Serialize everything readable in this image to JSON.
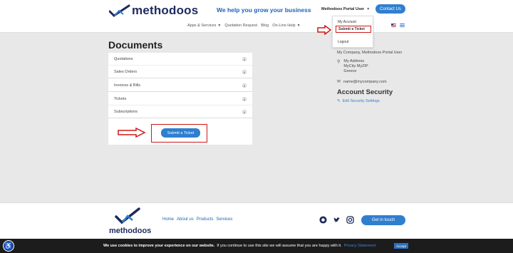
{
  "header": {
    "logo_text": "methodoos",
    "tagline": "We help you grow your business",
    "user_label": "Methodoos Portal User",
    "contact_label": "Contact Us"
  },
  "nav": {
    "items": [
      "Apps & Services",
      "Quotation Request",
      "Blog",
      "On-Line Help"
    ]
  },
  "dropdown": {
    "my_account": "My Account",
    "submit_ticket": "Submit a Ticket",
    "logout": "Logout"
  },
  "main": {
    "title": "Documents",
    "rows": [
      {
        "label": "Quotations",
        "count": "0"
      },
      {
        "label": "Sales Orders",
        "count": "0"
      },
      {
        "label": "Invoices & Bills",
        "count": "0"
      },
      {
        "label": "Tickets",
        "count": "0"
      },
      {
        "label": "Subscriptions",
        "count": "0"
      }
    ],
    "submit_button": "Submit a Ticket"
  },
  "profile": {
    "company": "My Company, Methodoos Portal User",
    "address": [
      "My Address",
      "MyCity MyZIP",
      "Greece"
    ],
    "email": "name@mycompany.com",
    "security_title": "Account Security",
    "security_link": "Edit Security Settings"
  },
  "footer": {
    "logo_text": "methodoos",
    "links": [
      "Home",
      "About us",
      "Products",
      "Services"
    ],
    "cta": "Get in touch"
  },
  "cookie": {
    "bold_text": "We use cookies to improve your experience on our website.",
    "text": "If you continue to use this site we will assume that you are happy with it.",
    "link": "Privacy Statement",
    "accept": "Accept"
  },
  "colors": {
    "accent": "#2f7fcf",
    "brand_dark": "#1f2a5c",
    "highlight": "#d01818"
  }
}
